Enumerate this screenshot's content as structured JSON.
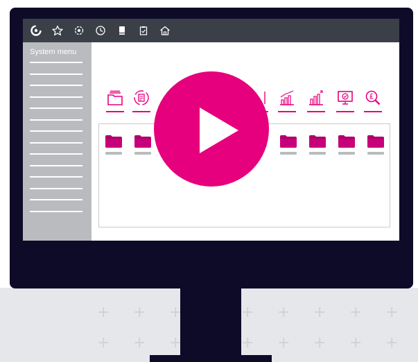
{
  "sidebar": {
    "title": "System menu",
    "item_count": 14
  },
  "toolbar_icons": [
    "gear-icon",
    "star-icon",
    "settings-cog-icon",
    "clock-icon",
    "book-icon",
    "clipboard-check-icon",
    "home-icon"
  ],
  "app_icons": [
    "stacked-folders-icon",
    "sync-document-icon",
    "bar-chart-icon",
    "bar-chart-up-icon",
    "monitor-check-icon",
    "pound-search-icon"
  ],
  "colors": {
    "accent": "#e6007e",
    "bezel": "#0e0b29",
    "topbar": "#3b4048",
    "sidebar": "#b9bbbe"
  },
  "video": {
    "play_icon": "play-icon"
  }
}
